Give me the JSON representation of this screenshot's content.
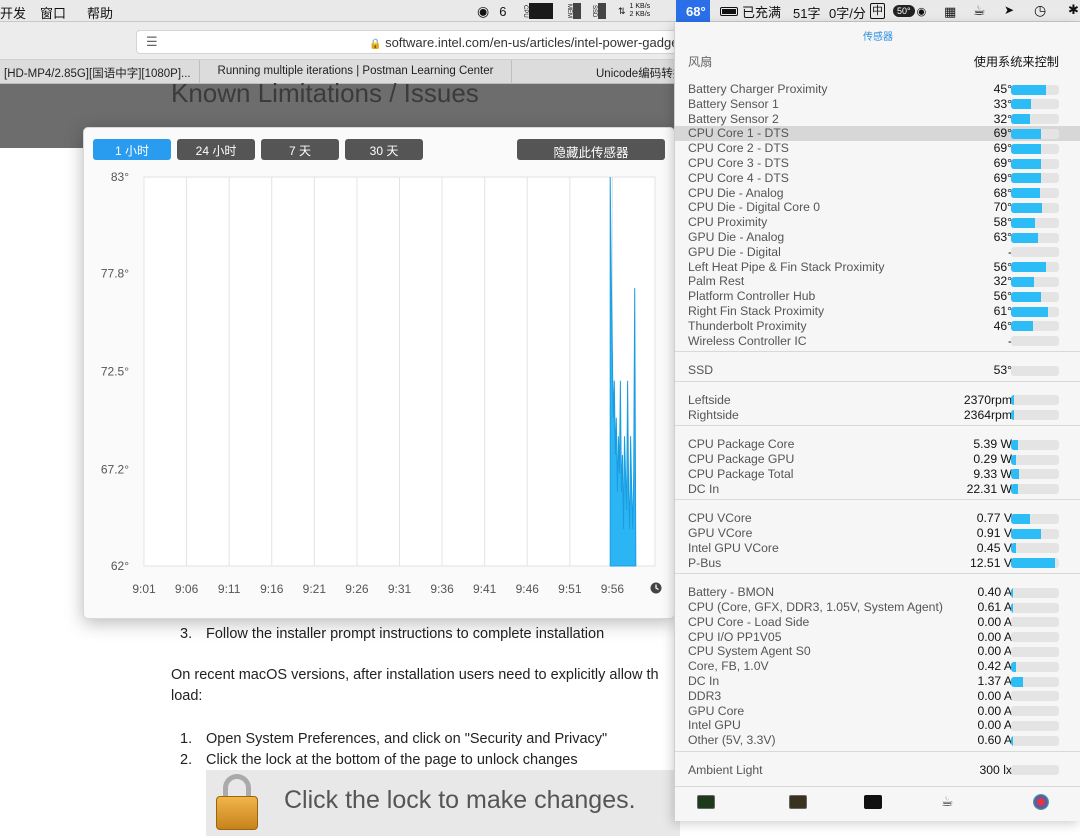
{
  "menubar": {
    "left_items": [
      "开发",
      "窗口",
      "帮助"
    ],
    "wechat_count": "6",
    "cpu_label": "CPU",
    "mem_label": "MEM",
    "ssd_label": "SSD",
    "net_up": "1 KB/s",
    "net_down": "2 KB/s",
    "temp": "68°",
    "battery": "已充满",
    "word_count": "51字",
    "speed": "0字/分",
    "ime": "中",
    "pill_temp": "50°"
  },
  "browser": {
    "url": "software.intel.com/en-us/articles/intel-power-gadge",
    "tabs": [
      "[HD-MP4/2.85G][国语中字][1080P]...",
      "Running multiple iterations | Postman Learning Center",
      "Unicode编码转换"
    ]
  },
  "page": {
    "banner_title": "Known Limitations / Issues",
    "step3_num": "3.",
    "step3": "Follow the installer prompt instructions to complete installation",
    "para1": "On recent macOS versions, after installation users need to explicitly allow th",
    "para2": "load:",
    "step1_num": "1.",
    "step1": "Open System Preferences, and click on \"Security and Privacy\"",
    "step2_num": "2.",
    "step2": "Click the lock at the bottom of the page to unlock changes",
    "lock_text": "Click the lock to make changes."
  },
  "chart_panel": {
    "ranges": [
      "1 小时",
      "24 小时",
      "7 天",
      "30 天"
    ],
    "active_range": "1 小时",
    "hide_button": "隐藏此传感器"
  },
  "chart_data": {
    "type": "area",
    "ylim": [
      62,
      83
    ],
    "ytick_labels": [
      "83°",
      "77.8°",
      "72.5°",
      "67.2°",
      "62°"
    ],
    "yticks": [
      83,
      77.8,
      72.5,
      67.2,
      62
    ],
    "xtick_labels": [
      "9:01",
      "9:06",
      "9:11",
      "9:16",
      "9:21",
      "9:26",
      "9:31",
      "9:36",
      "9:41",
      "9:46",
      "9:51",
      "9:56"
    ],
    "color": "#2cb5f5",
    "series": [
      {
        "values": [
          [
            9.929,
            83
          ],
          [
            9.931,
            78
          ],
          [
            9.933,
            74
          ],
          [
            9.935,
            70
          ],
          [
            9.937,
            72
          ],
          [
            9.939,
            68
          ],
          [
            9.941,
            70
          ],
          [
            9.943,
            66
          ],
          [
            9.945,
            69
          ],
          [
            9.947,
            67
          ],
          [
            9.949,
            72
          ],
          [
            9.951,
            66
          ],
          [
            9.953,
            68
          ],
          [
            9.955,
            64
          ],
          [
            9.957,
            69
          ],
          [
            9.959,
            67
          ],
          [
            9.961,
            65
          ],
          [
            9.963,
            72
          ],
          [
            9.965,
            66
          ],
          [
            9.967,
            64
          ],
          [
            9.969,
            69
          ],
          [
            9.971,
            66
          ],
          [
            9.973,
            64
          ],
          [
            9.975,
            67
          ],
          [
            9.977,
            77
          ],
          [
            9.979,
            62.5
          ]
        ]
      }
    ]
  },
  "sensors": {
    "title": "传感器",
    "fan_label": "风扇",
    "fan_control": "使用系统来控制",
    "temps": [
      {
        "name": "Battery Charger Proximity",
        "value": "45°",
        "level": 0.72
      },
      {
        "name": "Battery Sensor 1",
        "value": "33°",
        "level": 0.42
      },
      {
        "name": "Battery Sensor 2",
        "value": "32°",
        "level": 0.4
      },
      {
        "name": "CPU Core 1 - DTS",
        "value": "69°",
        "level": 0.62,
        "highlight": true
      },
      {
        "name": "CPU Core 2 - DTS",
        "value": "69°",
        "level": 0.62
      },
      {
        "name": "CPU Core 3 - DTS",
        "value": "69°",
        "level": 0.62
      },
      {
        "name": "CPU Core 4 - DTS",
        "value": "69°",
        "level": 0.62
      },
      {
        "name": "CPU Die - Analog",
        "value": "68°",
        "level": 0.6
      },
      {
        "name": "CPU Die - Digital Core 0",
        "value": "70°",
        "level": 0.64
      },
      {
        "name": "CPU Proximity",
        "value": "58°",
        "level": 0.5
      },
      {
        "name": "GPU Die - Analog",
        "value": "63°",
        "level": 0.56
      },
      {
        "name": "GPU Die - Digital",
        "value": "-",
        "level": 0
      },
      {
        "name": "Left Heat Pipe & Fin Stack Proximity",
        "value": "56°",
        "level": 0.72
      },
      {
        "name": "Palm Rest",
        "value": "32°",
        "level": 0.48
      },
      {
        "name": "Platform Controller Hub",
        "value": "56°",
        "level": 0.62
      },
      {
        "name": "Right Fin Stack Proximity",
        "value": "61°",
        "level": 0.78
      },
      {
        "name": "Thunderbolt Proximity",
        "value": "46°",
        "level": 0.46
      },
      {
        "name": "Wireless Controller IC",
        "value": "-",
        "level": 0
      }
    ],
    "ssd": [
      {
        "name": "SSD",
        "value": "53°",
        "level": 0
      }
    ],
    "fans": [
      {
        "name": "Leftside",
        "value": "2370rpm",
        "level": 0.06
      },
      {
        "name": "Rightside",
        "value": "2364rpm",
        "level": 0.06
      }
    ],
    "power": [
      {
        "name": "CPU Package Core",
        "value": "5.39 W",
        "level": 0.14
      },
      {
        "name": "CPU Package GPU",
        "value": "0.29 W",
        "level": 0.1
      },
      {
        "name": "CPU Package Total",
        "value": "9.33 W",
        "level": 0.16
      },
      {
        "name": "DC In",
        "value": "22.31 W",
        "level": 0.14
      }
    ],
    "voltage": [
      {
        "name": "CPU VCore",
        "value": "0.77 V",
        "level": 0.4
      },
      {
        "name": "GPU VCore",
        "value": "0.91 V",
        "level": 0.62
      },
      {
        "name": "Intel GPU VCore",
        "value": "0.45 V",
        "level": 0.1
      },
      {
        "name": "P-Bus",
        "value": "12.51 V",
        "level": 0.92
      }
    ],
    "current": [
      {
        "name": "Battery - BMON",
        "value": "0.40 A",
        "level": 0.04
      },
      {
        "name": "CPU (Core, GFX, DDR3, 1.05V, System Agent)",
        "value": "0.61 A",
        "level": 0.04
      },
      {
        "name": "CPU Core - Load Side",
        "value": "0.00 A",
        "level": 0
      },
      {
        "name": "CPU I/O PP1V05",
        "value": "0.00 A",
        "level": 0
      },
      {
        "name": "CPU System Agent S0",
        "value": "0.00 A",
        "level": 0
      },
      {
        "name": "Core, FB, 1.0V",
        "value": "0.42 A",
        "level": 0.1
      },
      {
        "name": "DC In",
        "value": "1.37 A",
        "level": 0.26
      },
      {
        "name": "DDR3",
        "value": "0.00 A",
        "level": 0
      },
      {
        "name": "GPU Core",
        "value": "0.00 A",
        "level": 0
      },
      {
        "name": "Intel GPU",
        "value": "0.00 A",
        "level": 0
      },
      {
        "name": "Other (5V, 3.3V)",
        "value": "0.60 A",
        "level": 0.04
      }
    ],
    "light": [
      {
        "name": "Ambient Light",
        "value": "300 lx",
        "level": 0
      }
    ]
  }
}
